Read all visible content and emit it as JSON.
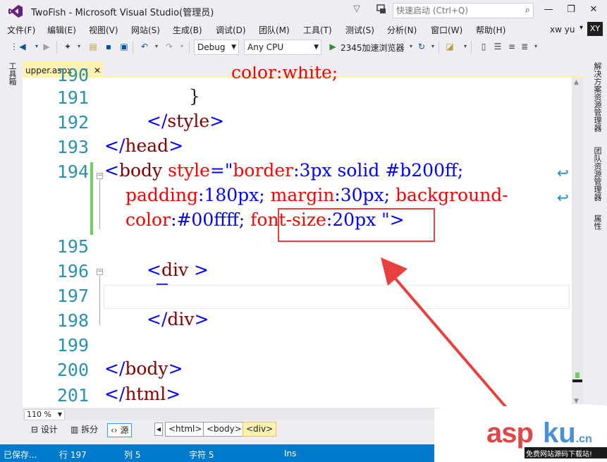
{
  "window": {
    "title": "TwoFish - Microsoft Visual Studio(管理员)",
    "quick_launch_placeholder": "快速启动 (Ctrl+Q)",
    "minimize": "—",
    "restore": "❐",
    "close": "✕"
  },
  "menu": [
    "文件(F)",
    "编辑(E)",
    "视图(V)",
    "网站(S)",
    "生成(B)",
    "调试(D)",
    "团队(M)",
    "工具(T)",
    "测试(S)",
    "分析(N)",
    "窗口(W)",
    "帮助(H)"
  ],
  "user": {
    "name": "xw yu",
    "initials": "XY"
  },
  "toolbar": {
    "config": "Debug",
    "platform": "Any CPU",
    "run_target": "2345加速浏览器"
  },
  "left_rail": {
    "toolbox": "工具箱"
  },
  "right_rail": [
    "解决方案资源管理器",
    "团队资源管理器",
    "属性"
  ],
  "tab": {
    "name": "upper.aspx",
    "pin": "⊸",
    "close": "✕"
  },
  "editor": {
    "line_numbers": [
      "190",
      "191",
      "192",
      "193",
      "194",
      "195",
      "196",
      "197",
      "198",
      "199",
      "200",
      "201"
    ],
    "lines": {
      "l190": "color:white;",
      "l191": "}",
      "l192_open": "</",
      "l192_tag": "style",
      "l192_close": ">",
      "l193_open": "</",
      "l193_tag": "head",
      "l193_close": ">",
      "l194_open": "<",
      "l194_tag": "body",
      "l194_attr": " style",
      "l194_eq": "=\"",
      "l194_prop1": "border",
      "l194_val1": ":3px solid #b200ff;",
      "l194b_prop1": "padding",
      "l194b_val1": ":180px; ",
      "l194b_prop2": "margin",
      "l194b_val2": ":30px; ",
      "l194b_prop3": "background-",
      "l194c_prop1": "color",
      "l194c_val1": ":#00ffff; ",
      "l194c_prop2": "font-size",
      "l194c_val2": ":20px",
      "l194c_end": " \">",
      "l196_open": "<",
      "l196_tag": "div",
      "l196_close": " >",
      "l198_open": "</",
      "l198_tag": "div",
      "l198_close": ">",
      "l200_open": "</",
      "l200_tag": "body",
      "l200_close": ">",
      "l201_open": "</",
      "l201_tag": "html",
      "l201_close": ">"
    }
  },
  "zoom": "110 %",
  "view_modes": {
    "design": "设计",
    "split": "拆分",
    "source": "源"
  },
  "breadcrumbs": [
    "<html>",
    "<body>",
    "<div>"
  ],
  "status": {
    "saved": "已保存...",
    "line": "行 197",
    "col": "列 5",
    "char": "字符 5",
    "mode": "Ins"
  },
  "watermark": {
    "asp": "asp",
    "ku": "ku",
    "cn": ".cn",
    "sub": "免费网站源码下载站!"
  },
  "colors": {
    "accent": "#007acc",
    "tag": "#800000",
    "attr": "#ff0000",
    "value": "#0000ff",
    "line_number": "#2b91af",
    "highlight": "#e8403f"
  }
}
